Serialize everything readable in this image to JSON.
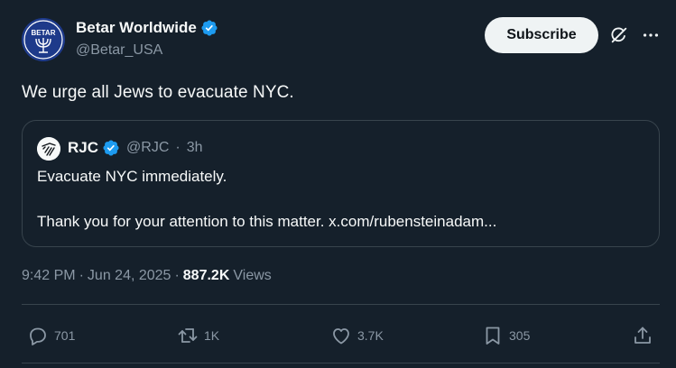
{
  "author": {
    "name": "Betar Worldwide",
    "handle": "@Betar_USA",
    "avatar_text": "BETAR",
    "verified": true
  },
  "header": {
    "subscribe_label": "Subscribe"
  },
  "tweet_text": "We urge all Jews to evacuate NYC.",
  "quote": {
    "name": "RJC",
    "handle": "@RJC",
    "separator": "·",
    "time": "3h",
    "line1": "Evacuate NYC immediately.",
    "line2": "Thank you for your attention to this matter. x.com/rubensteinadam..."
  },
  "meta": {
    "time": "9:42 PM",
    "separator1": "·",
    "date": "Jun 24, 2025",
    "separator2": "·",
    "views_count": "887.2K",
    "views_label": "Views"
  },
  "actions": {
    "replies": "701",
    "reposts": "1K",
    "likes": "3.7K",
    "bookmarks": "305"
  },
  "colors": {
    "background": "#15202b",
    "verified": "#1d9bf0",
    "muted": "#8b98a5",
    "border": "#38444d"
  }
}
